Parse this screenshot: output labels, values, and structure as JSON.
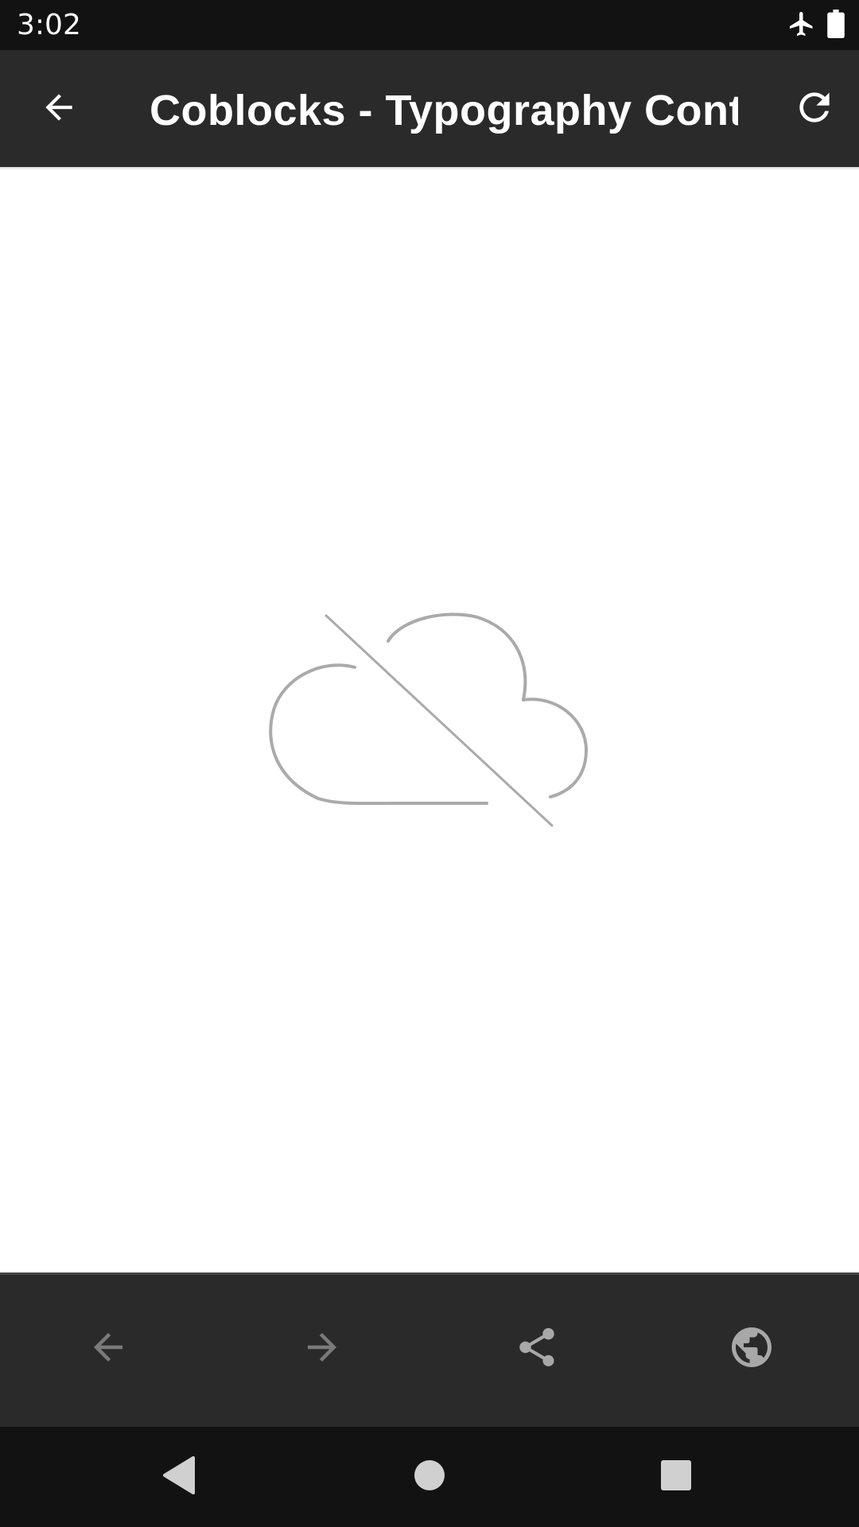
{
  "status_bar": {
    "time": "3:02",
    "icons": [
      "airplane-mode-icon",
      "battery-full-icon"
    ]
  },
  "app_bar": {
    "title": "Coblocks - Typography Cont…",
    "back_icon": "arrow-back-icon",
    "refresh_icon": "refresh-icon"
  },
  "content": {
    "illustration": "offline-cloud-icon"
  },
  "bottom_toolbar": {
    "items": [
      {
        "icon": "arrow-back-icon",
        "enabled": false
      },
      {
        "icon": "arrow-forward-icon",
        "enabled": false
      },
      {
        "icon": "share-icon",
        "enabled": true
      },
      {
        "icon": "globe-icon",
        "enabled": true
      }
    ]
  },
  "nav_bar": {
    "items": [
      "nav-back-icon",
      "nav-home-icon",
      "nav-recents-icon"
    ]
  },
  "colors": {
    "status_bar_bg": "#121212",
    "app_bar_bg": "#2a2a2a",
    "toolbar_bg": "#2a2a2a",
    "toolbar_icon_disabled": "#7a7a7a",
    "toolbar_icon_enabled": "#a8a8a8",
    "illustration_stroke": "#a9aaab"
  }
}
